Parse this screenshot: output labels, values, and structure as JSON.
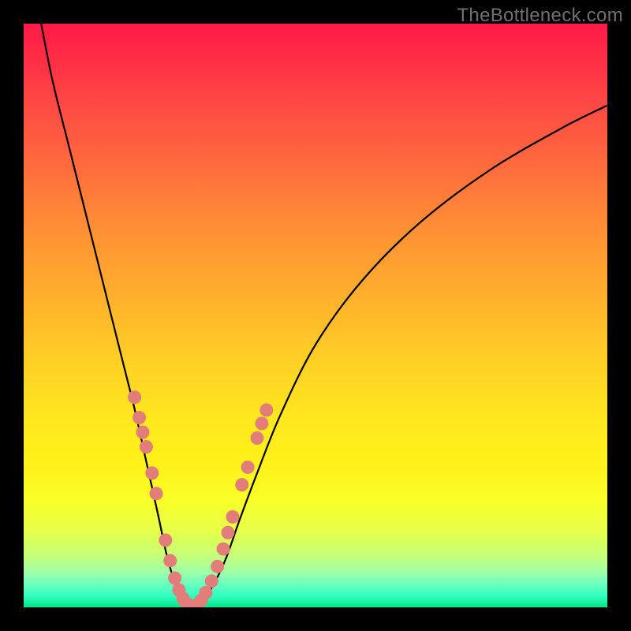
{
  "watermark": "TheBottleneck.com",
  "colors": {
    "frame": "#000000",
    "curve": "#000000",
    "dot_fill": "#e37d7a",
    "dot_stroke": "#e37d7a"
  },
  "chart_data": {
    "type": "line",
    "title": "",
    "xlabel": "",
    "ylabel": "",
    "xlim": [
      0,
      100
    ],
    "ylim": [
      0,
      100
    ],
    "grid": false,
    "series": [
      {
        "name": "bottleneck-curve",
        "x": [
          3,
          5,
          8,
          11,
          14,
          17,
          19,
          21,
          23,
          24.5,
          26,
          27.5,
          29,
          30,
          32,
          34.5,
          37,
          40,
          44,
          50,
          58,
          68,
          80,
          92,
          100
        ],
        "y": [
          100,
          90,
          78,
          66,
          54,
          42,
          34,
          25,
          16,
          9,
          4,
          1,
          0,
          0.5,
          3,
          8,
          15,
          23,
          33,
          45,
          56,
          66,
          75,
          82,
          86
        ]
      }
    ],
    "annotations": [
      {
        "name": "data-point-cluster",
        "note": "pink dots along the curve near the trough",
        "points_xy": [
          [
            19.0,
            36.0
          ],
          [
            19.8,
            32.5
          ],
          [
            20.4,
            30.0
          ],
          [
            21.0,
            27.5
          ],
          [
            22.0,
            23.0
          ],
          [
            22.7,
            19.5
          ],
          [
            24.3,
            11.5
          ],
          [
            25.1,
            8.0
          ],
          [
            25.9,
            5.0
          ],
          [
            26.6,
            3.0
          ],
          [
            27.3,
            1.5
          ],
          [
            28.0,
            0.6
          ],
          [
            28.8,
            0.2
          ],
          [
            29.6,
            0.4
          ],
          [
            30.4,
            1.2
          ],
          [
            31.2,
            2.5
          ],
          [
            32.2,
            4.5
          ],
          [
            33.2,
            7.0
          ],
          [
            34.2,
            10.0
          ],
          [
            35.0,
            12.8
          ],
          [
            35.8,
            15.5
          ],
          [
            37.4,
            21.0
          ],
          [
            38.4,
            24.0
          ],
          [
            40.0,
            29.0
          ],
          [
            40.8,
            31.5
          ],
          [
            41.6,
            33.8
          ]
        ]
      }
    ]
  }
}
